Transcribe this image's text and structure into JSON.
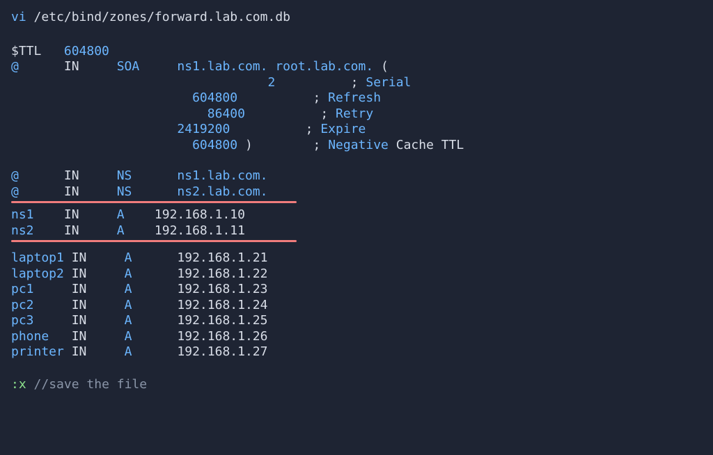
{
  "command": {
    "cmd": "vi",
    "path": "/etc/bind/zones/forward.lab.com.db"
  },
  "ttl": {
    "label": "$TTL",
    "value": "604800"
  },
  "soa": {
    "origin": "@",
    "class": "IN",
    "type": "SOA",
    "primary": "ns1.lab.com.",
    "email": "root.lab.com.",
    "open": "(",
    "close": ")",
    "params": [
      {
        "value": "2",
        "comment": "Serial",
        "pad": "      "
      },
      {
        "value": "604800",
        "comment": "Refresh",
        "pad": " "
      },
      {
        "value": "86400",
        "comment": "Retry",
        "pad": "  "
      },
      {
        "value": "2419200",
        "comment": "Expire",
        "pad": ""
      },
      {
        "value": "604800",
        "comment": "Negative",
        "pad": " ",
        "trailing": "Cache TTL"
      }
    ]
  },
  "ns_records": [
    {
      "name": "@",
      "class": "IN",
      "type": "NS",
      "value": "ns1.lab.com."
    },
    {
      "name": "@",
      "class": "IN",
      "type": "NS",
      "value": "ns2.lab.com."
    }
  ],
  "a_ns_records": [
    {
      "name": "ns1",
      "class": "IN",
      "type": "A",
      "value": "192.168.1.10"
    },
    {
      "name": "ns2",
      "class": "IN",
      "type": "A",
      "value": "192.168.1.11"
    }
  ],
  "a_host_records": [
    {
      "name": "laptop1",
      "class": "IN",
      "type": "A",
      "value": "192.168.1.21"
    },
    {
      "name": "laptop2",
      "class": "IN",
      "type": "A",
      "value": "192.168.1.22"
    },
    {
      "name": "pc1",
      "class": "IN",
      "type": "A",
      "value": "192.168.1.23"
    },
    {
      "name": "pc2",
      "class": "IN",
      "type": "A",
      "value": "192.168.1.24"
    },
    {
      "name": "pc3",
      "class": "IN",
      "type": "A",
      "value": "192.168.1.25"
    },
    {
      "name": "phone",
      "class": "IN",
      "type": "A",
      "value": "192.168.1.26"
    },
    {
      "name": "printer",
      "class": "IN",
      "type": "A",
      "value": "192.168.1.27"
    }
  ],
  "footer": {
    "cmd": ":x",
    "comment": "//save the file"
  }
}
